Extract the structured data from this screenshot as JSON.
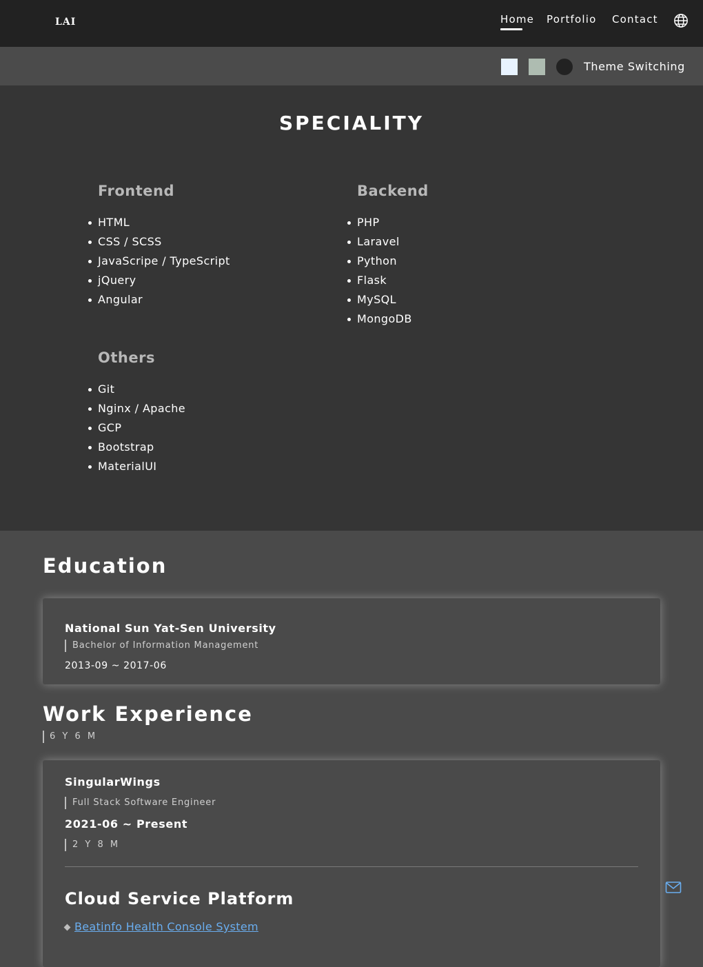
{
  "nav": {
    "logo": "LAI",
    "links": [
      "Home",
      "Portfolio",
      "Contact"
    ],
    "active": "Home",
    "language_icon": "globe-icon"
  },
  "theme": {
    "label": "Theme Switching",
    "swatches": [
      {
        "name": "light",
        "color": "#e8f3ff"
      },
      {
        "name": "sage",
        "color": "#aebcb1"
      },
      {
        "name": "dark",
        "color": "#222222"
      }
    ]
  },
  "speciality": {
    "title": "SPECIALITY",
    "groups": [
      {
        "title": "Frontend",
        "items": [
          "HTML",
          "CSS / SCSS",
          "JavaScripe / TypeScript",
          "jQuery",
          "Angular"
        ]
      },
      {
        "title": "Backend",
        "items": [
          "PHP",
          "Laravel",
          "Python",
          "Flask",
          "MySQL",
          "MongoDB"
        ]
      },
      {
        "title": "Others",
        "items": [
          "Git",
          "Nginx / Apache",
          "GCP",
          "Bootstrap",
          "MaterialUI"
        ]
      }
    ]
  },
  "education": {
    "title": "Education",
    "school": "National Sun Yat-Sen University",
    "degree": "Bachelor of Information Management",
    "period": "2013-09 ~ 2017-06"
  },
  "work": {
    "title": "Work Experience",
    "total": "6 Y 6 M",
    "jobs": [
      {
        "company": "SingularWings",
        "role": "Full Stack Software Engineer",
        "period": "2021-06 ~ Present",
        "duration": "2 Y 8 M",
        "project_title": "Cloud Service Platform",
        "project_link": "Beatinfo Health Console System"
      }
    ]
  },
  "fab": {
    "icon": "mail-icon"
  }
}
